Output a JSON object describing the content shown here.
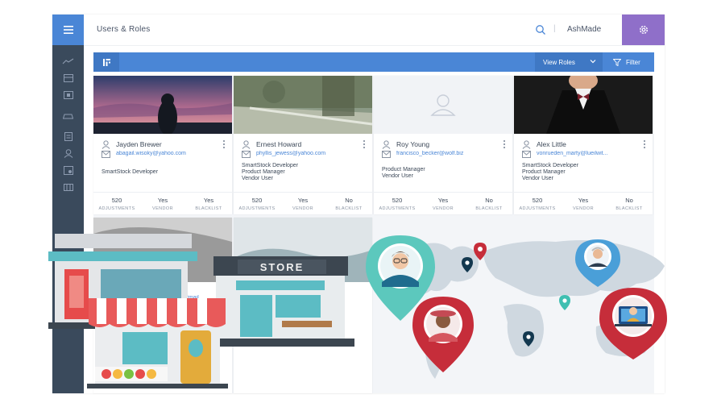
{
  "header": {
    "title": "Users & Roles",
    "separator": "|",
    "username": "AshMade"
  },
  "toolbar": {
    "view_roles_label": "View Roles",
    "filter_label": "Filter"
  },
  "icons": {
    "menu": "hamburger-icon",
    "settings": "gear-icon",
    "search": "search-icon",
    "filter": "funnel-icon",
    "view_toggle": "grid-toggle-icon"
  },
  "colors": {
    "primary": "#4a86d6",
    "sidebar": "#3a4a5c",
    "settings": "#8f6fc9",
    "link": "#4a86d6"
  },
  "cards": [
    {
      "name": "Jayden Brewer",
      "email": "abagail.wisoky@yahoo.com",
      "roles": [
        "SmartStock Developer"
      ],
      "stats": [
        {
          "value": "520",
          "label": "ADJUSTMENTS"
        },
        {
          "value": "Yes",
          "label": "VENDOR"
        },
        {
          "value": "Yes",
          "label": "BLACKLIST"
        }
      ]
    },
    {
      "name": "Ernest Howard",
      "email": "phyllis_jewess@yahoo.com",
      "roles": [
        "SmartStock Developer",
        "Product Manager",
        "Vendor User"
      ],
      "stats": [
        {
          "value": "520",
          "label": "ADJUSTMENTS"
        },
        {
          "value": "Yes",
          "label": "VENDOR"
        },
        {
          "value": "No",
          "label": "BLACKLIST"
        }
      ]
    },
    {
      "name": "Roy Young",
      "email": "francisco_becker@wolf.biz",
      "roles": [
        "Product Manager",
        "Vendor User"
      ],
      "stats": [
        {
          "value": "520",
          "label": "ADJUSTMENTS"
        },
        {
          "value": "Yes",
          "label": "VENDOR"
        },
        {
          "value": "No",
          "label": "BLACKLIST"
        }
      ]
    },
    {
      "name": "Alex Little",
      "email": "vonrueden_marty@lueilwit...",
      "roles": [
        "SmartStock Developer",
        "Product Manager",
        "Vendor User"
      ],
      "stats": [
        {
          "value": "520",
          "label": "ADJUSTMENTS"
        },
        {
          "value": "Yes",
          "label": "VENDOR"
        },
        {
          "value": "No",
          "label": "BLACKLIST"
        }
      ]
    }
  ],
  "partial_card_email": "tmail...",
  "store_sign": "STORE"
}
